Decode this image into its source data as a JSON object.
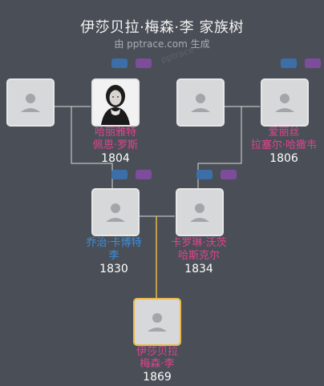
{
  "header": {
    "title": "伊莎贝拉·梅森·李 家族树",
    "subtitle": "由 pptrace.com 生成",
    "watermark": "pptrace"
  },
  "people": {
    "p1": {
      "name1": "",
      "name2": "",
      "year": ""
    },
    "p2": {
      "name1": "哈丽雅特",
      "name2": "佩恩·罗斯",
      "year": "1804"
    },
    "p3": {
      "name1": "",
      "name2": "",
      "year": ""
    },
    "p4": {
      "name1": "爱丽丝",
      "name2": "拉塞尔·哈撒韦",
      "year": "1806"
    },
    "p5": {
      "name1": "乔治·卡博特",
      "name2": "李",
      "year": "1830"
    },
    "p6": {
      "name1": "卡罗琳·沃茨",
      "name2": "哈斯克尔",
      "year": "1834"
    },
    "p7": {
      "name1": "伊莎贝拉",
      "name2": "梅森·李",
      "year": "1869"
    }
  },
  "colors": {
    "female": "#e0438e",
    "male": "#3a8fe0",
    "focus_border": "#e9b949",
    "background": "#4a4f57"
  }
}
